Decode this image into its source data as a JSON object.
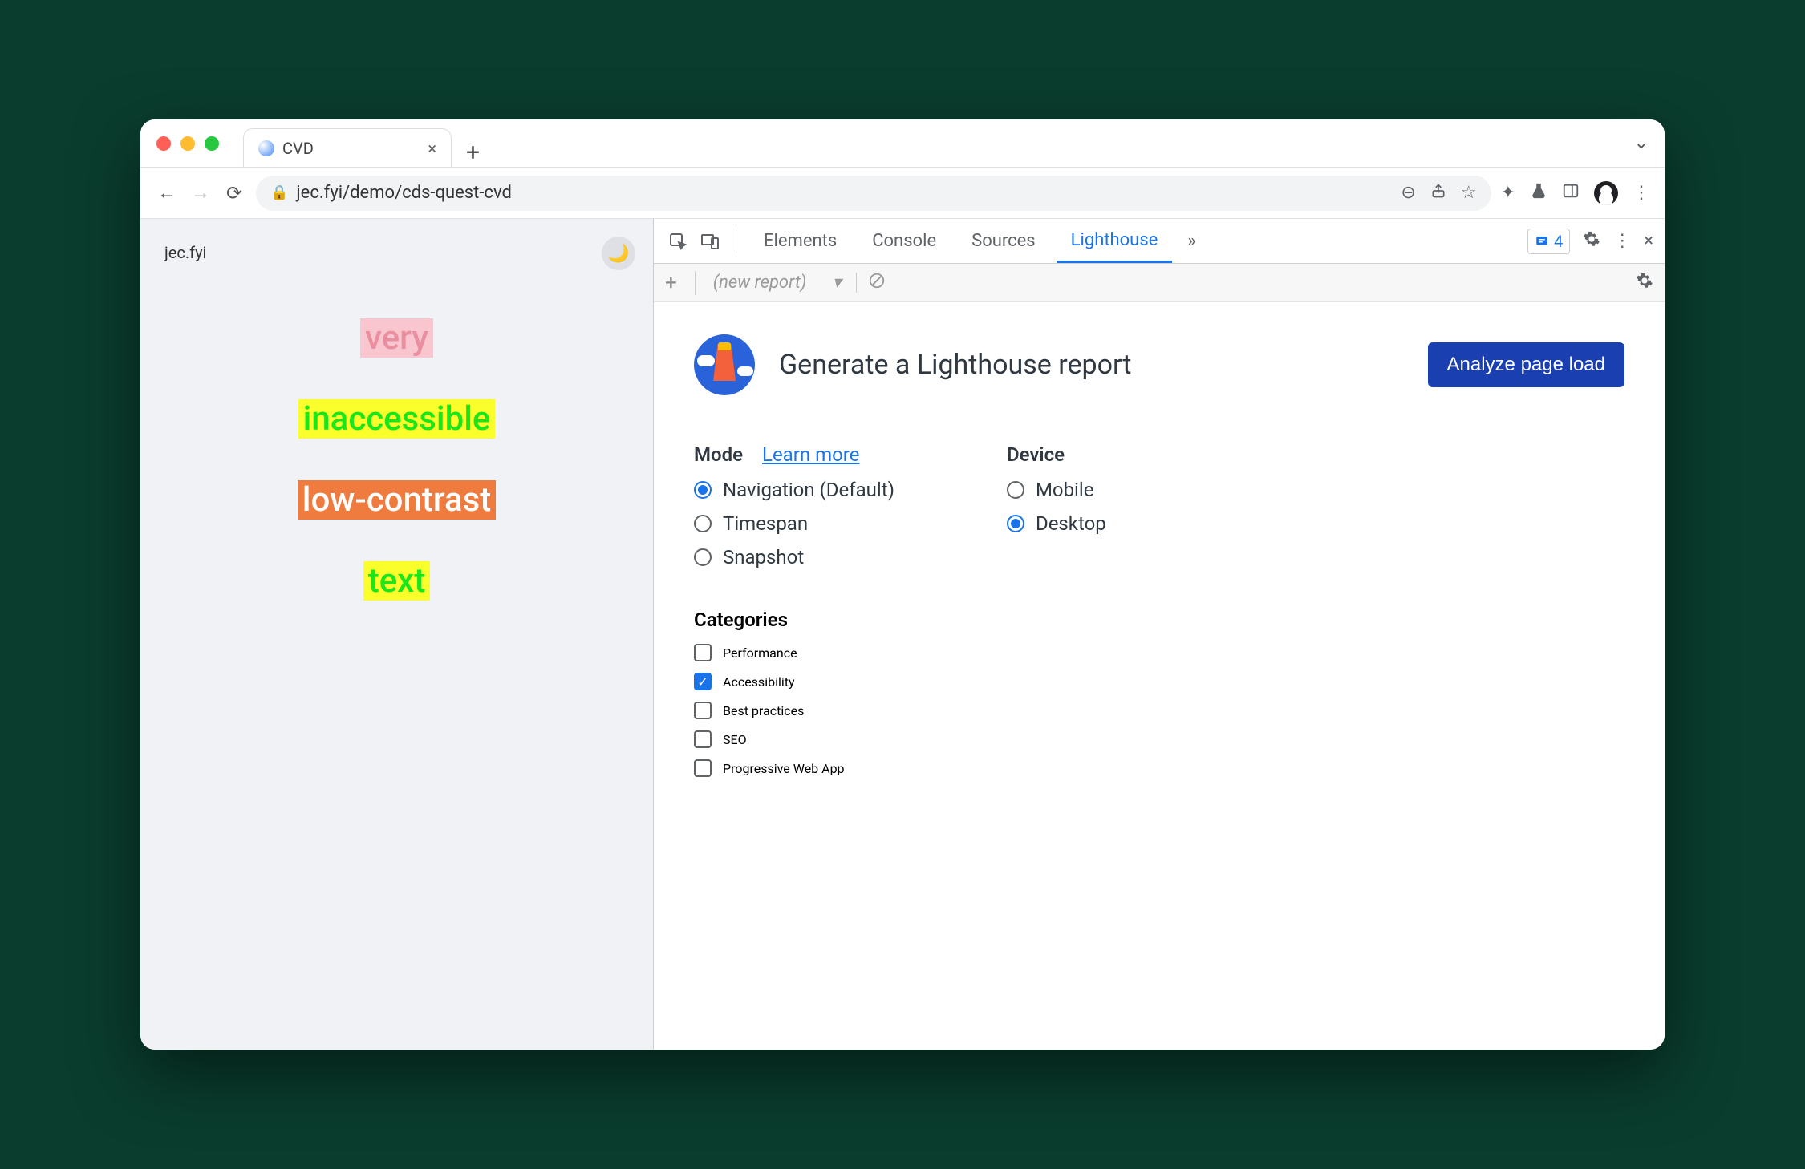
{
  "browser": {
    "tab_title": "CVD",
    "url": "jec.fyi/demo/cds-quest-cvd"
  },
  "page": {
    "site_label": "jec.fyi",
    "words": [
      "very",
      "inaccessible",
      "low-contrast",
      "text"
    ]
  },
  "devtools": {
    "tabs": [
      "Elements",
      "Console",
      "Sources",
      "Lighthouse"
    ],
    "active_tab": "Lighthouse",
    "issues_count": "4",
    "subbar_new_report": "(new report)"
  },
  "lighthouse": {
    "title": "Generate a Lighthouse report",
    "analyze_btn": "Analyze page load",
    "mode_label": "Mode",
    "learn_more": "Learn more",
    "modes": [
      {
        "label": "Navigation (Default)",
        "selected": true
      },
      {
        "label": "Timespan",
        "selected": false
      },
      {
        "label": "Snapshot",
        "selected": false
      }
    ],
    "device_label": "Device",
    "devices": [
      {
        "label": "Mobile",
        "selected": false
      },
      {
        "label": "Desktop",
        "selected": true
      }
    ],
    "categories_label": "Categories",
    "categories": [
      {
        "label": "Performance",
        "selected": false
      },
      {
        "label": "Accessibility",
        "selected": true
      },
      {
        "label": "Best practices",
        "selected": false
      },
      {
        "label": "SEO",
        "selected": false
      },
      {
        "label": "Progressive Web App",
        "selected": false
      }
    ]
  }
}
